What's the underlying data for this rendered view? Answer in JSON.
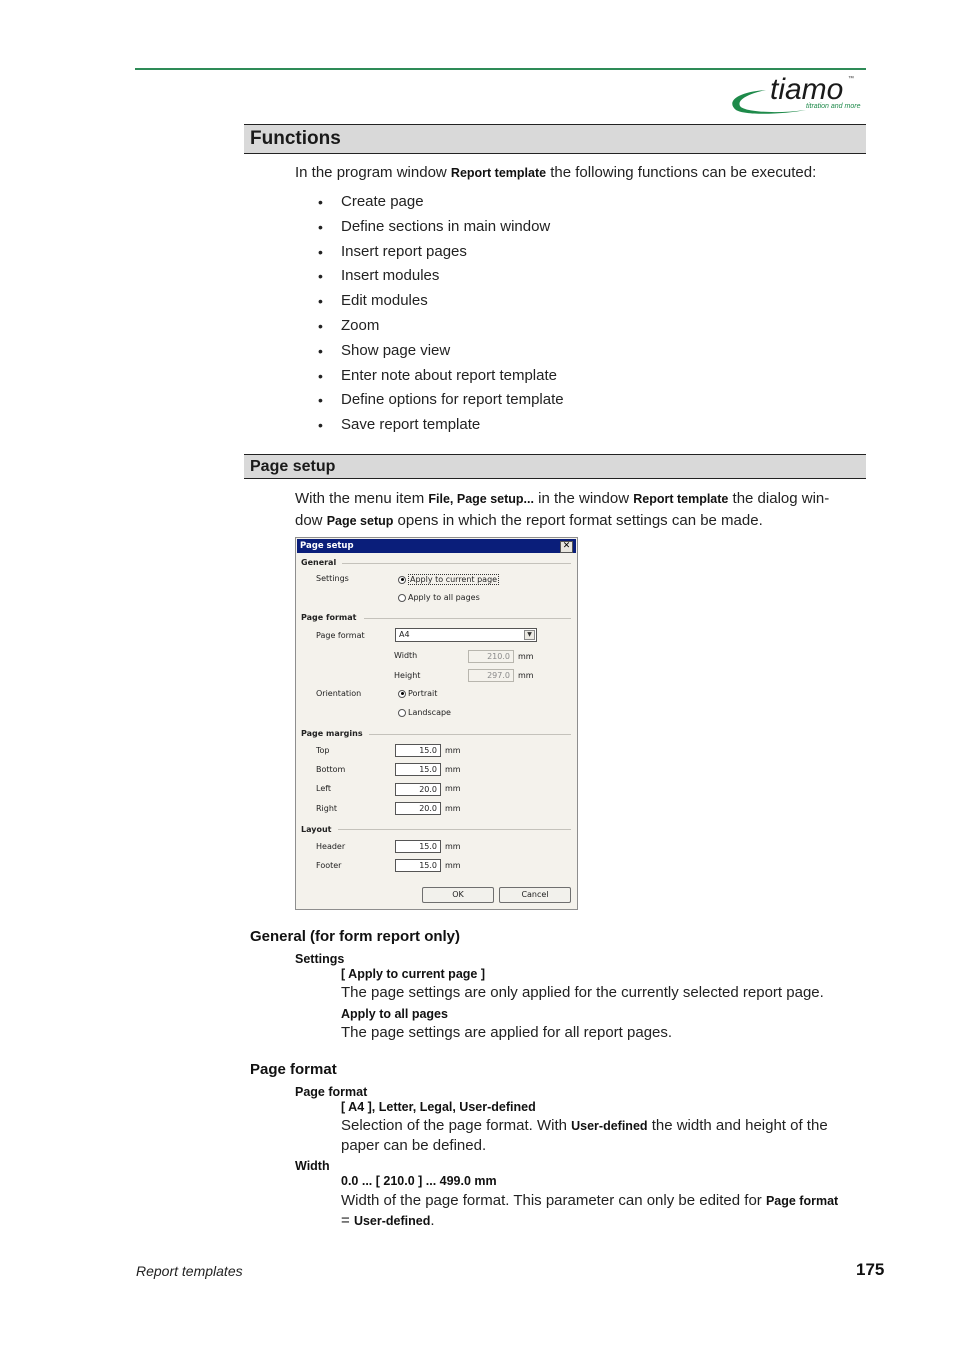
{
  "header": {
    "logo_text": "tiamo",
    "logo_tm": "™",
    "logo_tagline": "titration and more",
    "brand_color": "#2e8b57"
  },
  "functions": {
    "title": "Functions",
    "intro_pre": "In the program window ",
    "intro_bold": "Report template",
    "intro_post": " the following functions can be executed:",
    "items": [
      "Create page",
      "Define sections in main window",
      "Insert report pages",
      "Insert modules",
      "Edit modules",
      "Zoom",
      "Show page view",
      "Enter note about report template",
      "Define options for report template",
      "Save report template"
    ]
  },
  "page_setup": {
    "title": "Page setup",
    "p1": "With the menu item ",
    "b1": "File, Page setup...",
    "p2": " in the window ",
    "b2": "Report template",
    "p3": " the dialog win-",
    "p4": "dow ",
    "b3": "Page setup",
    "p5": " opens in which the report format settings can be made."
  },
  "dialog": {
    "title": "Page setup",
    "close_glyph": "✕",
    "general": {
      "heading": "General",
      "settings_label": "Settings",
      "options": [
        "Apply to current page",
        "Apply to all pages"
      ],
      "selected": "Apply to current page"
    },
    "page_format": {
      "heading": "Page format",
      "format_label": "Page format",
      "format_value": "A4",
      "width_label": "Width",
      "width_value": "210.0",
      "height_label": "Height",
      "height_value": "297.0",
      "unit": "mm",
      "orientation_label": "Orientation",
      "orientation_options": [
        "Portrait",
        "Landscape"
      ],
      "orientation_selected": "Portrait"
    },
    "margins": {
      "heading": "Page margins",
      "top_label": "Top",
      "top_value": "15.0",
      "bottom_label": "Bottom",
      "bottom_value": "15.0",
      "left_label": "Left",
      "left_value": "20.0",
      "right_label": "Right",
      "right_value": "20.0",
      "unit": "mm"
    },
    "layout": {
      "heading": "Layout",
      "header_label": "Header",
      "header_value": "15.0",
      "footer_label": "Footer",
      "footer_value": "15.0",
      "unit": "mm"
    },
    "ok_label": "OK",
    "cancel_label": "Cancel"
  },
  "general_section": {
    "title": "General (for form report only)",
    "param": "Settings",
    "opt1": "[ Apply to current page ]",
    "opt1_desc": "The page settings are only applied for the currently selected report page.",
    "opt2": "Apply to all pages",
    "opt2_desc": "The page settings are applied for all report pages."
  },
  "page_format_section": {
    "title": "Page format",
    "param1": "Page format",
    "param1_values": "[ A4 ], Letter, Legal, User-defined",
    "param1_desc_pre": "Selection of the page format. With ",
    "param1_desc_bold": "User-defined",
    "param1_desc_post": " the width and height of the paper can be defined.",
    "param2": "Width",
    "param2_values": "0.0 ... [ 210.0 ] ... 499.0 mm",
    "param2_desc_pre": "Width of the page format. This parameter can only be edited for ",
    "param2_desc_bold1": "Page format",
    "param2_desc_eq": "= ",
    "param2_desc_bold2": "User-defined",
    "param2_desc_end": "."
  },
  "footer": {
    "section": "Report templates",
    "page_number": "175"
  }
}
